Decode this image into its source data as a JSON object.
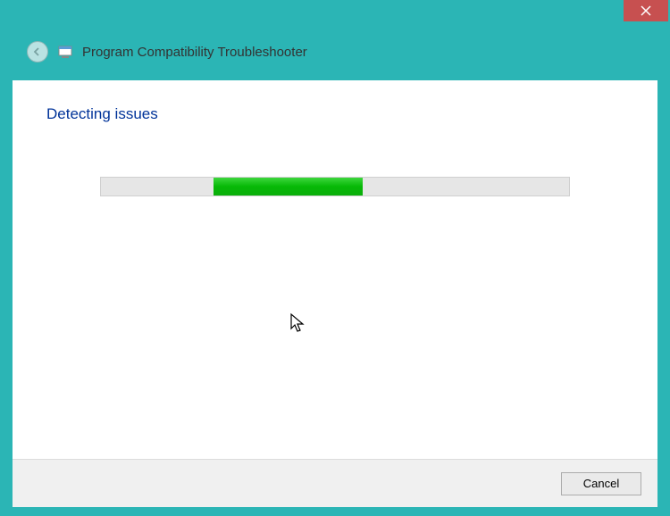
{
  "window": {
    "title": "Program Compatibility Troubleshooter"
  },
  "content": {
    "heading": "Detecting issues"
  },
  "footer": {
    "cancel_label": "Cancel"
  },
  "progress": {
    "indeterminate": true
  }
}
